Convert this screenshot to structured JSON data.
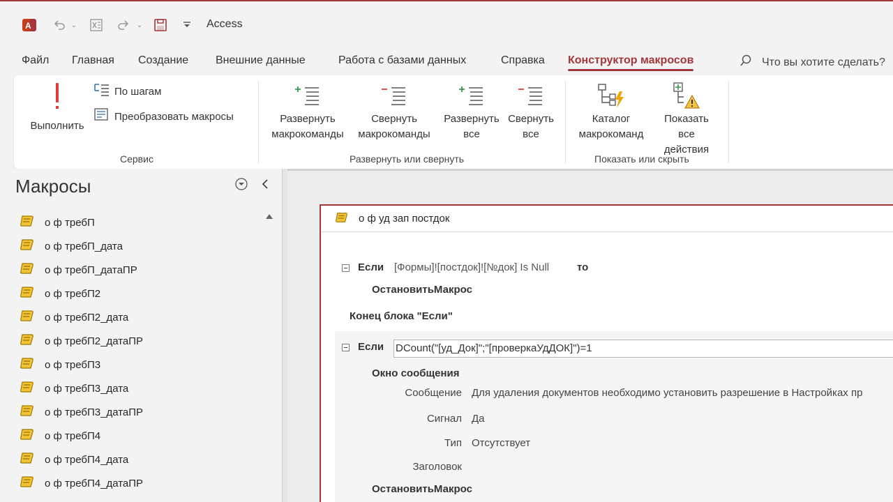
{
  "titlebar": {
    "app_title": "Access"
  },
  "menu": {
    "tabs": [
      {
        "label": "Файл"
      },
      {
        "label": "Главная"
      },
      {
        "label": "Создание"
      },
      {
        "label": "Внешние данные"
      },
      {
        "label": "Работа с базами данных"
      },
      {
        "label": "Справка"
      },
      {
        "label": "Конструктор макросов"
      }
    ],
    "tell_me": "Что вы хотите сделать?"
  },
  "ribbon": {
    "run": "Выполнить",
    "single_step": "По шагам",
    "convert": "Преобразовать макросы",
    "group_tools": "Сервис",
    "expand_actions": "Развернуть макрокоманды",
    "collapse_actions": "Свернуть макрокоманды",
    "expand_all": "Развернуть все",
    "collapse_all": "Свернуть все",
    "group_expand": "Развернуть или свернуть",
    "action_catalog": "Каталог макрокоманд",
    "show_all_actions": "Показать все действия",
    "group_show": "Показать или скрыть",
    "accent_color": "#a4373a"
  },
  "nav": {
    "title": "Макросы",
    "items": [
      "о ф требП",
      "о ф требП_дата",
      "о ф требП_датаПР",
      "о ф требП2",
      "о ф требП2_дата",
      "о ф требП2_датаПР",
      "о ф требП3",
      "о ф требП3_дата",
      "о ф требП3_датаПР",
      "о ф требП4",
      "о ф требП4_дата",
      "о ф требП4_датаПР"
    ]
  },
  "macro": {
    "name": "о ф уд зап постдок",
    "if1_kw": "Если",
    "if1_cond": "[Формы]![постдок]![№док] Is Null",
    "then_kw": "то",
    "stop1": "ОстановитьМакрос",
    "end_if": "Конец блока \"Если\"",
    "if2_kw": "Если",
    "if2_cond": "DCount(\"[уд_Док]\";\"[проверкаУдДОК]\")=1",
    "msgbox": "Окно сообщения",
    "arg_message_label": "Сообщение",
    "arg_message_value": "Для удаления документов необходимо установить разрешение в Настройках пр",
    "arg_beep_label": "Сигнал",
    "arg_beep_value": "Да",
    "arg_type_label": "Тип",
    "arg_type_value": "Отсутствует",
    "arg_title_label": "Заголовок",
    "stop2": "ОстановитьМакрос"
  }
}
